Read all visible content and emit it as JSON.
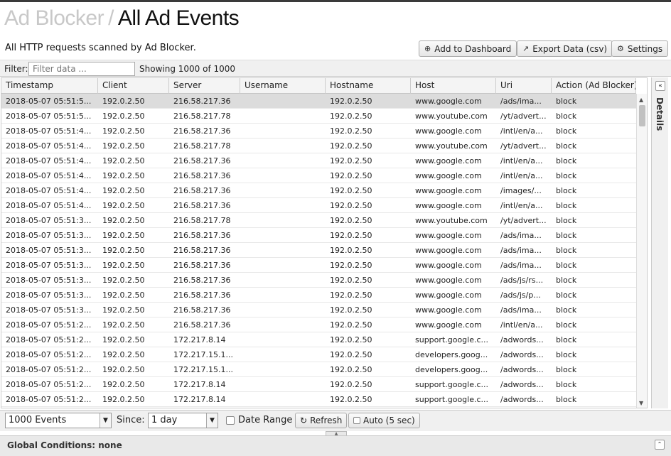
{
  "header": {
    "breadcrumb_parent": "Ad Blocker",
    "separator": "/",
    "title": "All Ad Events",
    "subtitle": "All HTTP requests scanned by Ad Blocker.",
    "buttons": {
      "add_dashboard": "Add to Dashboard",
      "export": "Export Data (csv)",
      "settings": "Settings"
    }
  },
  "filter": {
    "label": "Filter:",
    "placeholder": "Filter data ...",
    "showing": "Showing 1000 of 1000"
  },
  "table": {
    "columns": [
      "Timestamp",
      "Client",
      "Server",
      "Username",
      "Hostname",
      "Host",
      "Uri",
      "Action (Ad Blocker)"
    ],
    "rows": [
      [
        "2018-05-07 05:51:5...",
        "192.0.2.50",
        "216.58.217.36",
        "",
        "192.0.2.50",
        "www.google.com",
        "/ads/ima...",
        "block"
      ],
      [
        "2018-05-07 05:51:5...",
        "192.0.2.50",
        "216.58.217.78",
        "",
        "192.0.2.50",
        "www.youtube.com",
        "/yt/advert...",
        "block"
      ],
      [
        "2018-05-07 05:51:4...",
        "192.0.2.50",
        "216.58.217.36",
        "",
        "192.0.2.50",
        "www.google.com",
        "/intl/en/a...",
        "block"
      ],
      [
        "2018-05-07 05:51:4...",
        "192.0.2.50",
        "216.58.217.78",
        "",
        "192.0.2.50",
        "www.youtube.com",
        "/yt/advert...",
        "block"
      ],
      [
        "2018-05-07 05:51:4...",
        "192.0.2.50",
        "216.58.217.36",
        "",
        "192.0.2.50",
        "www.google.com",
        "/intl/en/a...",
        "block"
      ],
      [
        "2018-05-07 05:51:4...",
        "192.0.2.50",
        "216.58.217.36",
        "",
        "192.0.2.50",
        "www.google.com",
        "/intl/en/a...",
        "block"
      ],
      [
        "2018-05-07 05:51:4...",
        "192.0.2.50",
        "216.58.217.36",
        "",
        "192.0.2.50",
        "www.google.com",
        "/images/...",
        "block"
      ],
      [
        "2018-05-07 05:51:4...",
        "192.0.2.50",
        "216.58.217.36",
        "",
        "192.0.2.50",
        "www.google.com",
        "/intl/en/a...",
        "block"
      ],
      [
        "2018-05-07 05:51:3...",
        "192.0.2.50",
        "216.58.217.78",
        "",
        "192.0.2.50",
        "www.youtube.com",
        "/yt/advert...",
        "block"
      ],
      [
        "2018-05-07 05:51:3...",
        "192.0.2.50",
        "216.58.217.36",
        "",
        "192.0.2.50",
        "www.google.com",
        "/ads/ima...",
        "block"
      ],
      [
        "2018-05-07 05:51:3...",
        "192.0.2.50",
        "216.58.217.36",
        "",
        "192.0.2.50",
        "www.google.com",
        "/ads/ima...",
        "block"
      ],
      [
        "2018-05-07 05:51:3...",
        "192.0.2.50",
        "216.58.217.36",
        "",
        "192.0.2.50",
        "www.google.com",
        "/ads/ima...",
        "block"
      ],
      [
        "2018-05-07 05:51:3...",
        "192.0.2.50",
        "216.58.217.36",
        "",
        "192.0.2.50",
        "www.google.com",
        "/ads/js/rs...",
        "block"
      ],
      [
        "2018-05-07 05:51:3...",
        "192.0.2.50",
        "216.58.217.36",
        "",
        "192.0.2.50",
        "www.google.com",
        "/ads/js/p...",
        "block"
      ],
      [
        "2018-05-07 05:51:3...",
        "192.0.2.50",
        "216.58.217.36",
        "",
        "192.0.2.50",
        "www.google.com",
        "/ads/ima...",
        "block"
      ],
      [
        "2018-05-07 05:51:2...",
        "192.0.2.50",
        "216.58.217.36",
        "",
        "192.0.2.50",
        "www.google.com",
        "/intl/en/a...",
        "block"
      ],
      [
        "2018-05-07 05:51:2...",
        "192.0.2.50",
        "172.217.8.14",
        "",
        "192.0.2.50",
        "support.google.c...",
        "/adwords...",
        "block"
      ],
      [
        "2018-05-07 05:51:2...",
        "192.0.2.50",
        "172.217.15.1...",
        "",
        "192.0.2.50",
        "developers.goog...",
        "/adwords...",
        "block"
      ],
      [
        "2018-05-07 05:51:2...",
        "192.0.2.50",
        "172.217.15.1...",
        "",
        "192.0.2.50",
        "developers.goog...",
        "/adwords...",
        "block"
      ],
      [
        "2018-05-07 05:51:2...",
        "192.0.2.50",
        "172.217.8.14",
        "",
        "192.0.2.50",
        "support.google.c...",
        "/adwords...",
        "block"
      ],
      [
        "2018-05-07 05:51:2...",
        "192.0.2.50",
        "172.217.8.14",
        "",
        "192.0.2.50",
        "support.google.c...",
        "/adwords...",
        "block"
      ]
    ]
  },
  "details_panel": {
    "label": "Details"
  },
  "bottom": {
    "events_select": "1000 Events",
    "since_label": "Since:",
    "since_select": "1 day",
    "date_range_label": "Date Range",
    "refresh_label": "Refresh",
    "auto_label": "Auto (5 sec)"
  },
  "global": {
    "label": "Global Conditions: none"
  }
}
